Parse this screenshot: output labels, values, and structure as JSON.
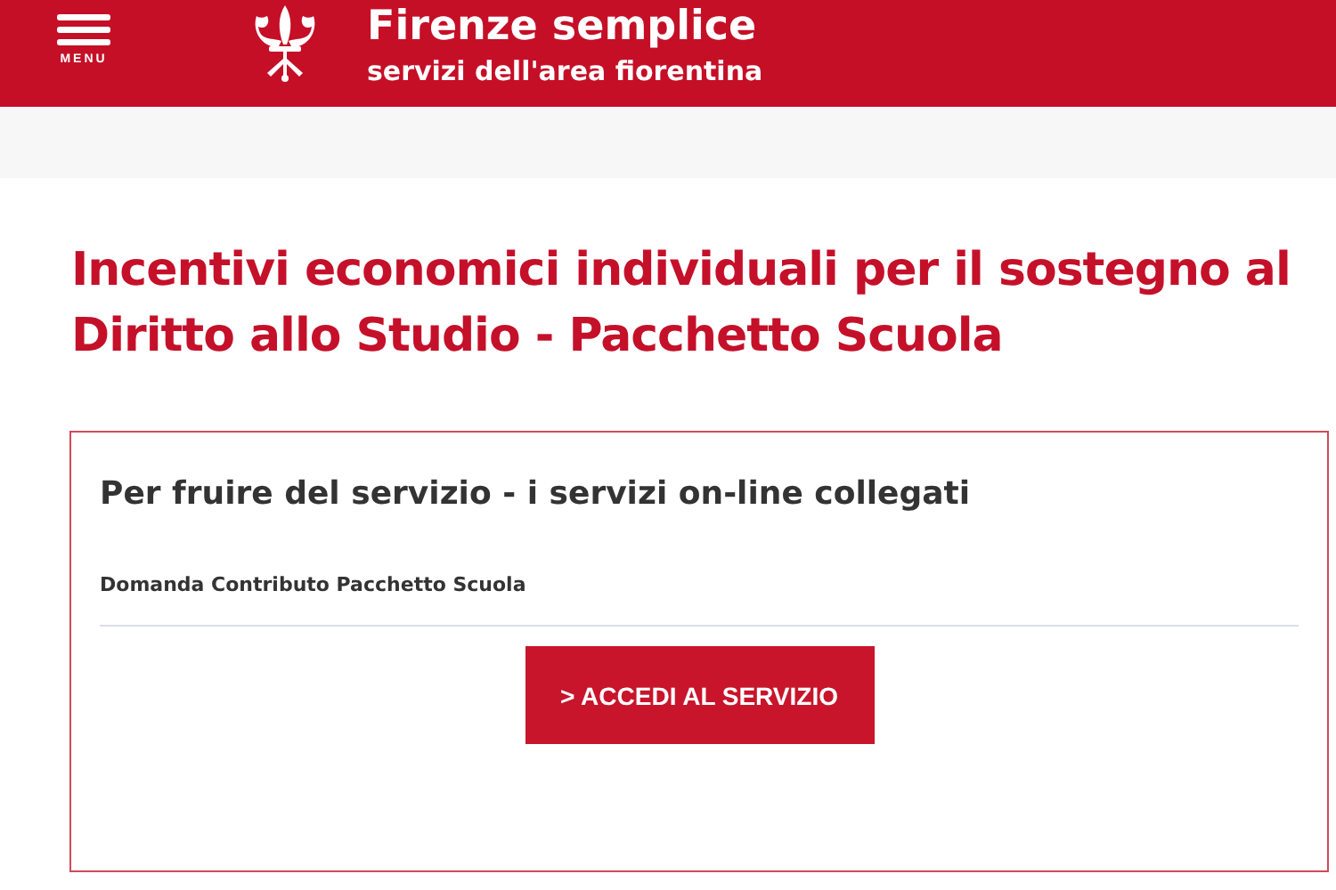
{
  "header": {
    "menu_label": "MENU",
    "title": "Firenze semplice",
    "subtitle": "servizi dell'area fiorentina"
  },
  "page_title": "Incentivi economici individuali per il sostegno al Diritto allo Studio - Pacchetto Scuola",
  "card": {
    "heading": "Per fruire del servizio - i servizi on-line collegati",
    "service_name": "Domanda Contributo Pacchetto Scuola",
    "button": "> ACCEDI AL SERVIZIO"
  }
}
